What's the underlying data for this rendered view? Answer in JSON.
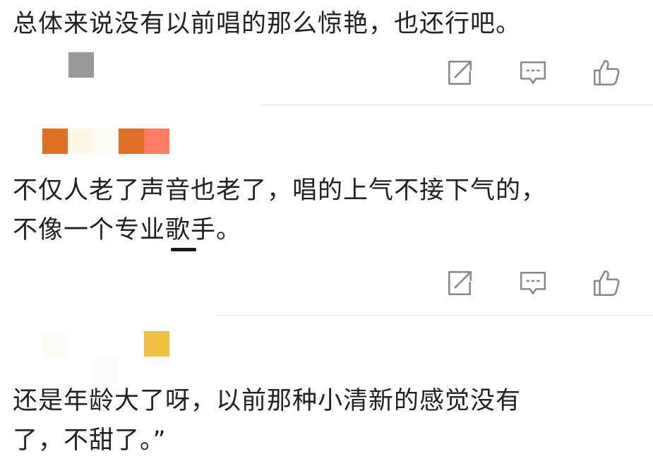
{
  "comments": [
    {
      "text": "总体来说没有以前唱的那么惊艳，也还行吧。",
      "avatar_colors": [
        "#999999"
      ]
    },
    {
      "username_colors": [
        "#e07025",
        "#fff8e8",
        "#fdfaf3",
        "#e07025",
        "#ff7a60"
      ],
      "text": "不仅人老了声音也老了，唱的上气不接下气的，\n不像一个专业歌手。"
    },
    {
      "username_colors": [
        "#fdfbf5",
        "#fafafa",
        "#f0c040"
      ],
      "text": "还是年龄大了呀，以前那种小清新的感觉没有\n了，不甜了。”"
    }
  ],
  "action_icons": [
    "share-icon",
    "comment-icon",
    "like-icon"
  ],
  "colors": {
    "icon_stroke": "#888888",
    "divider": "#e6e6e6",
    "text": "#222222"
  }
}
